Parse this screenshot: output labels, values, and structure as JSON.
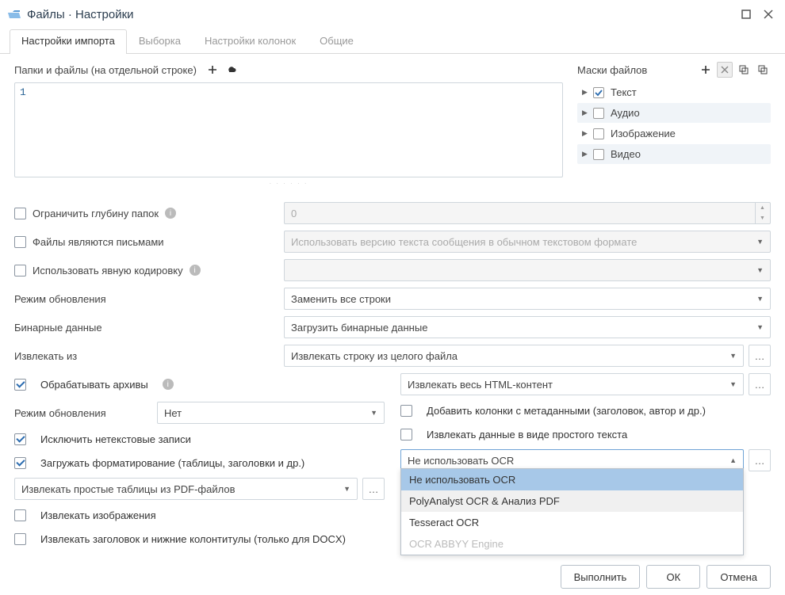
{
  "window": {
    "title": "Файлы · Настройки"
  },
  "tabs": {
    "t0": "Настройки импорта",
    "t1": "Выборка",
    "t2": "Настройки колонок",
    "t3": "Общие"
  },
  "folders_files": {
    "label": "Папки и файлы (на отдельной строке)",
    "content": "1"
  },
  "masks": {
    "label": "Маски файлов",
    "items": {
      "i0": "Текст",
      "i1": "Аудио",
      "i2": "Изображение",
      "i3": "Видео"
    }
  },
  "form": {
    "limit_depth": "Ограничить глубину папок",
    "limit_depth_value": "0",
    "files_are_mails": "Файлы являются письмами",
    "files_are_mails_placeholder": "Использовать версию текста сообщения в обычном текстовом формате",
    "use_encoding": "Использовать явную кодировку",
    "update_mode": "Режим обновления",
    "update_mode_value": "Заменить все строки",
    "binary_data": "Бинарные данные",
    "binary_data_value": "Загрузить бинарные данные",
    "extract_from": "Извлекать из",
    "extract_from_value": "Извлекать строку из целого файла",
    "process_archives": "Обрабатывать архивы",
    "html_content_value": "Извлекать весь HTML-контент",
    "update_mode2": "Режим обновления",
    "update_mode2_value": "Нет",
    "add_meta_cols": "Добавить колонки с метаданными (заголовок, автор и др.)",
    "exclude_nontext": "Исключить нетекстовые записи",
    "extract_plain": "Извлекать данные в виде простого текста",
    "load_formatting": "Загружать форматирование (таблицы, заголовки и др.)",
    "ocr_value": "Не использовать OCR",
    "extract_pdf_tables": "Извлекать простые таблицы из PDF-файлов",
    "extract_images": "Извлекать изображения",
    "extract_headers_docx": "Извлекать заголовок и нижние колонтитулы (только для DOCX)"
  },
  "ocr_options": {
    "o0": "Не использовать OCR",
    "o1": "PolyAnalyst OCR & Анализ PDF",
    "o2": "Tesseract OCR",
    "o3": "OCR ABBYY Engine"
  },
  "buttons": {
    "execute": "Выполнить",
    "ok": "ОК",
    "cancel": "Отмена"
  }
}
